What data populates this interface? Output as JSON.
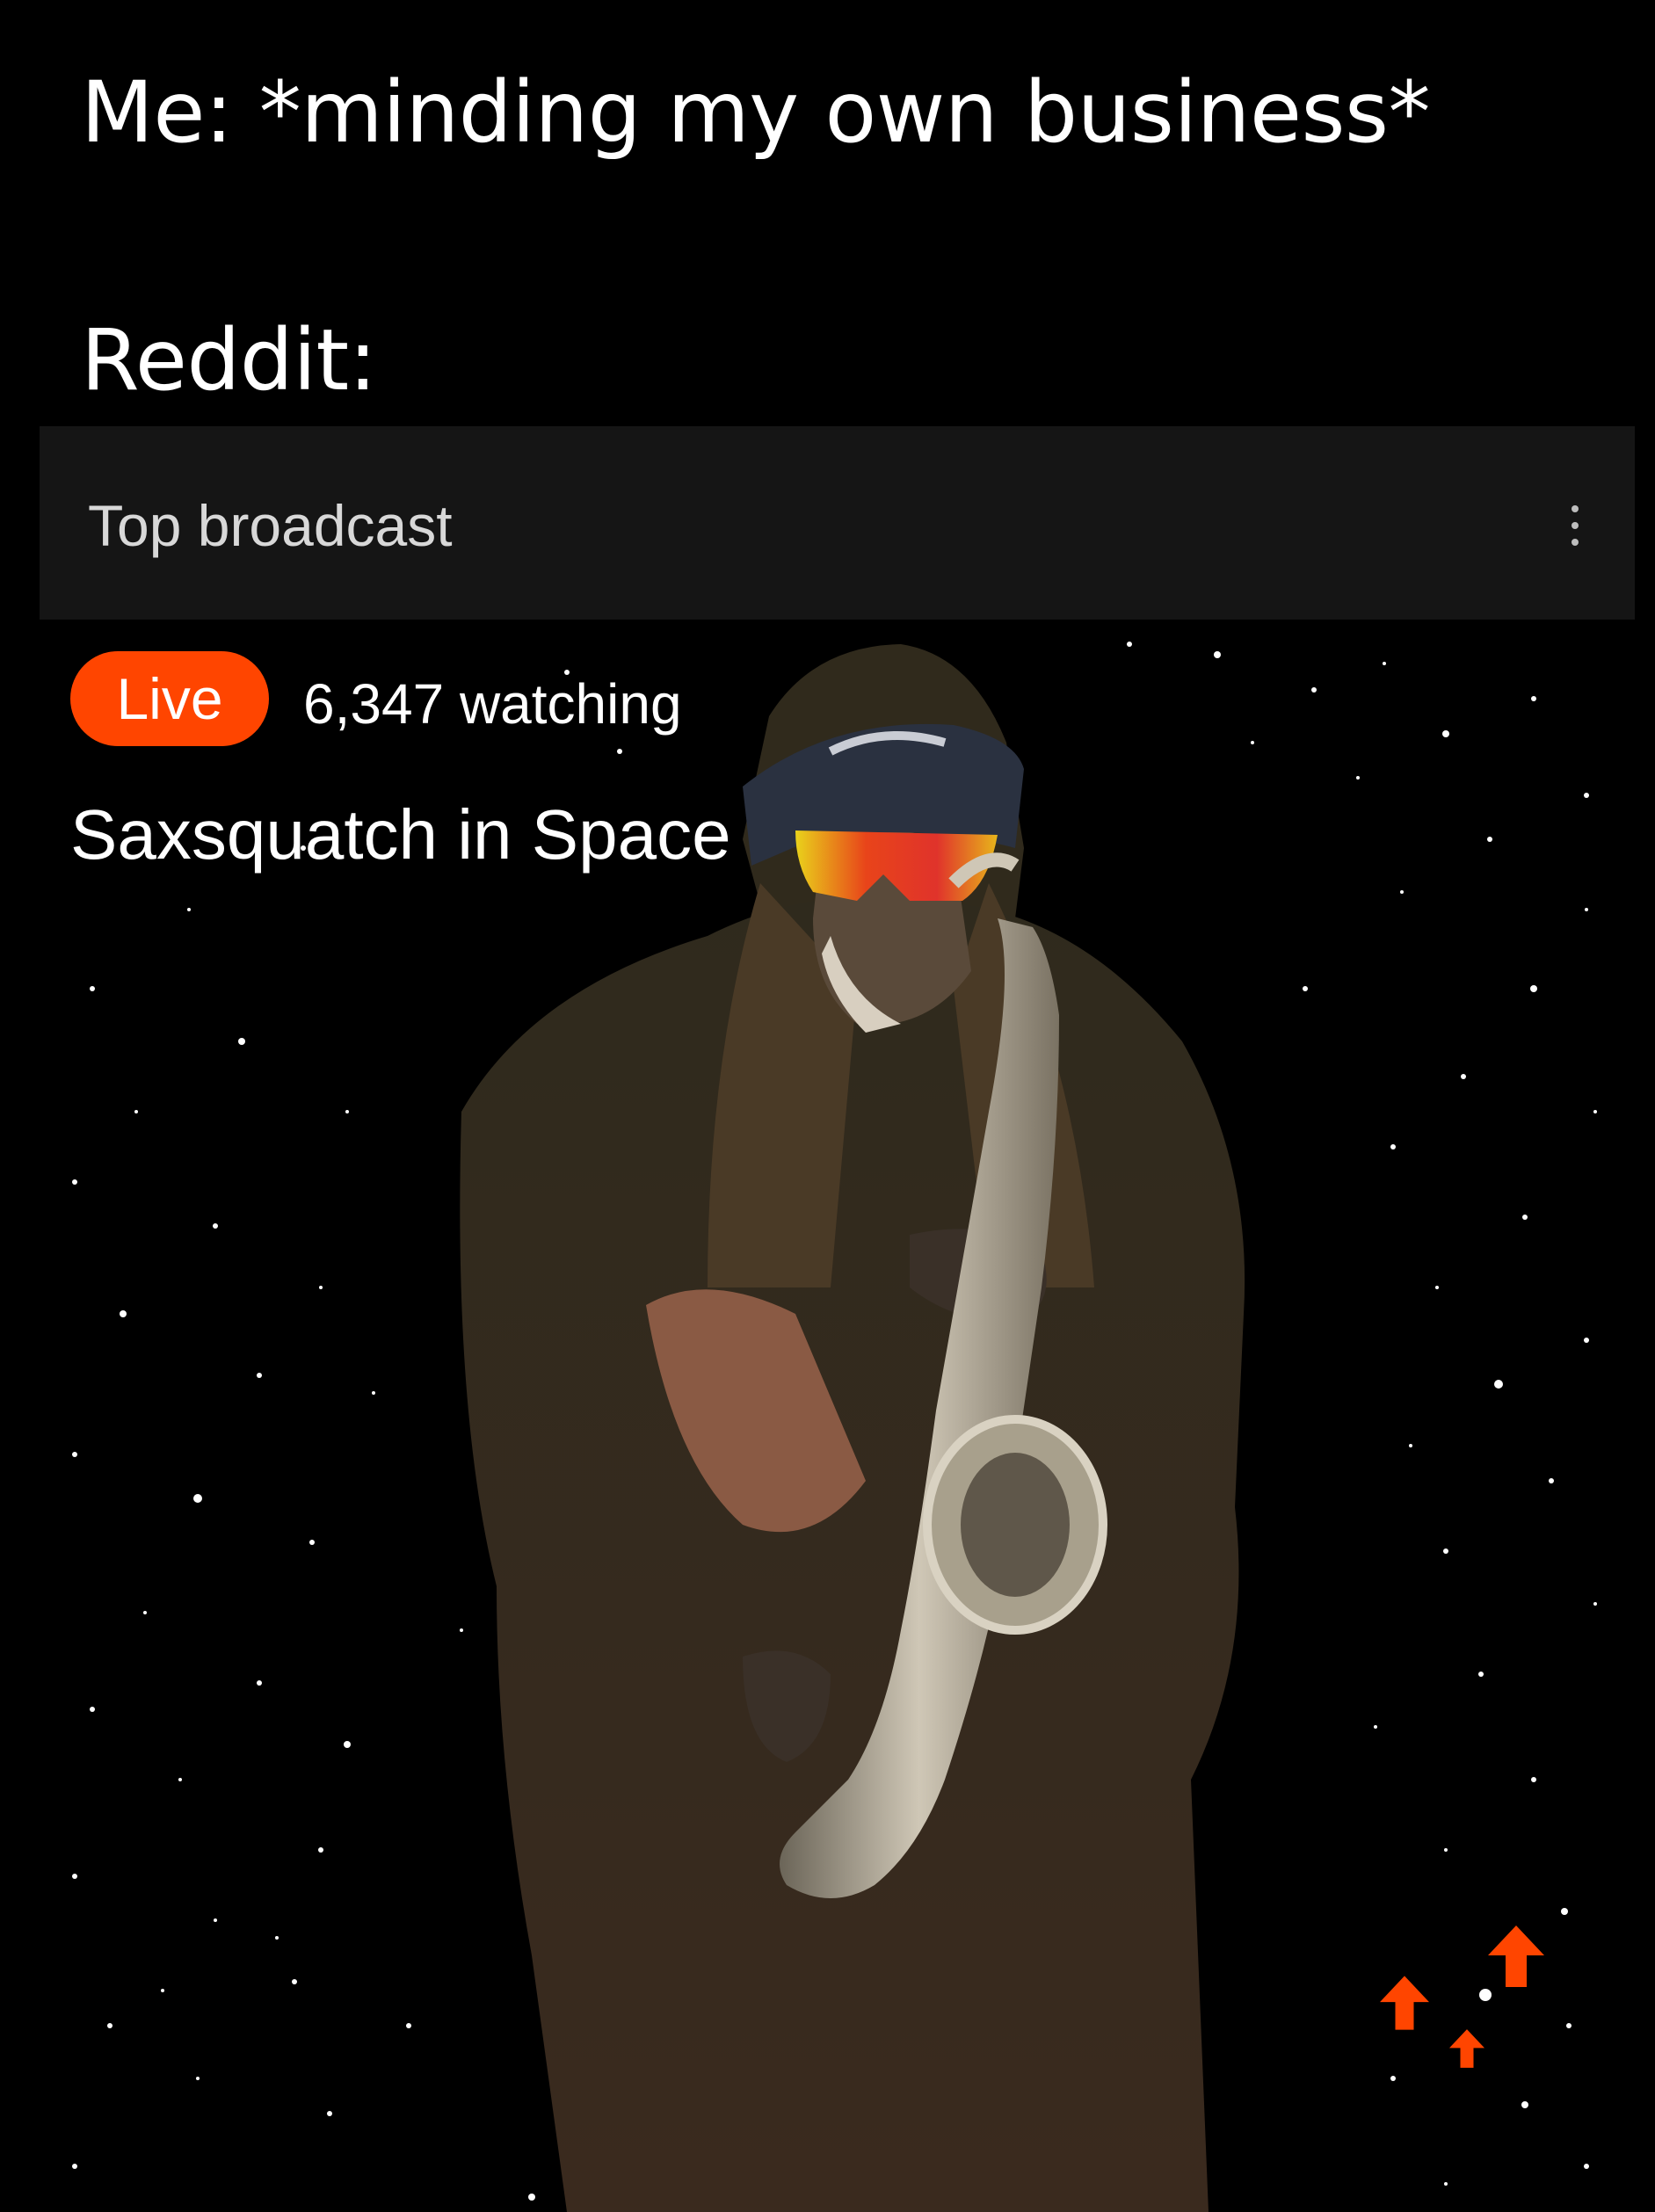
{
  "caption": {
    "top": "Me: *minding my own business*",
    "bottom": "Reddit:"
  },
  "broadcast": {
    "header_title": "Top broadcast",
    "more_icon": "vertical-ellipsis-icon",
    "live_label": "Live",
    "viewer_count": "6,347 watching",
    "stream_title": "Saxsquatch in Space"
  },
  "colors": {
    "live_badge": "#ff4500",
    "upvote": "#ff4500",
    "header_bg": "#151515",
    "background": "#000000"
  },
  "icons": {
    "floating_reaction": "upvote-arrow-icon"
  }
}
